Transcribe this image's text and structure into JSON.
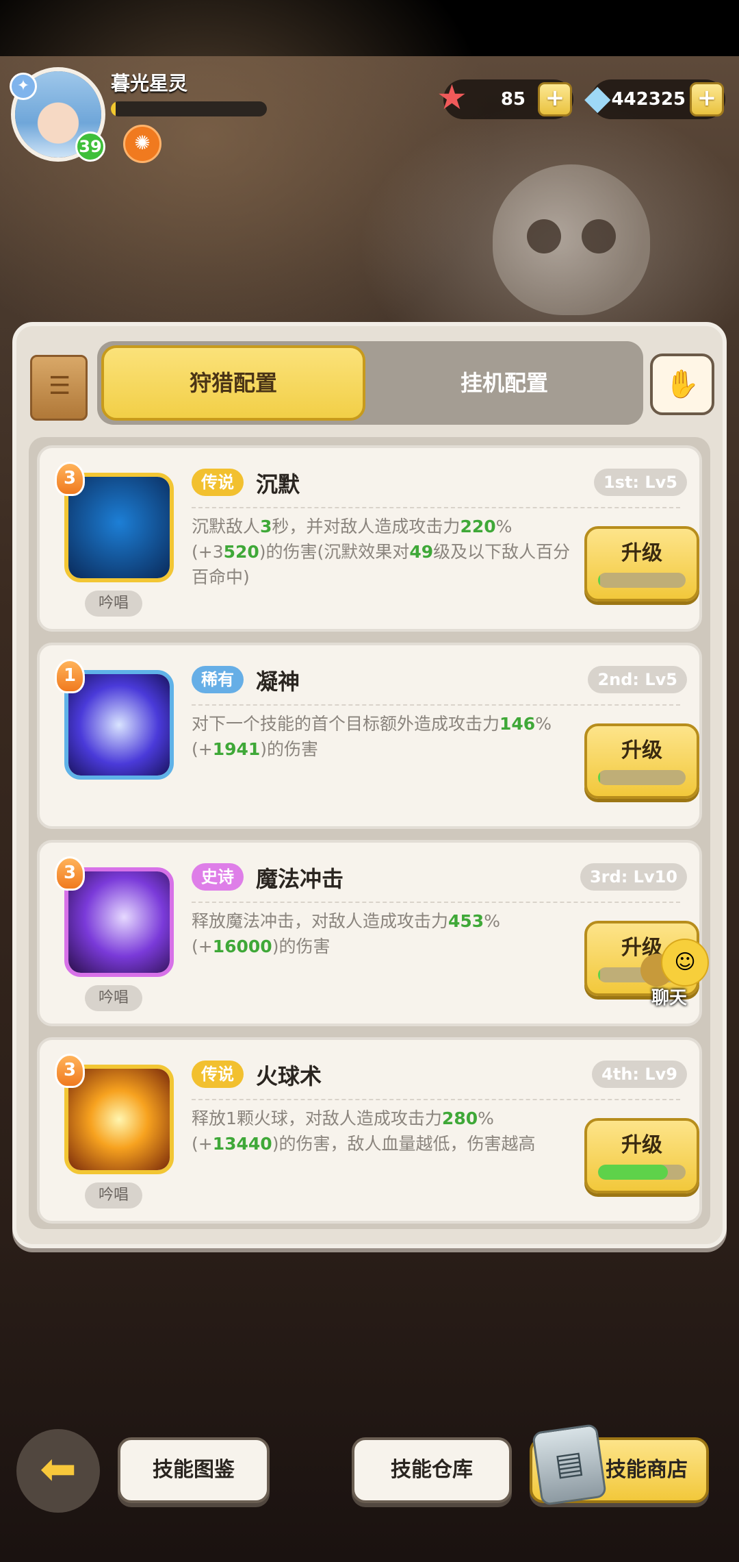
{
  "player": {
    "name": "暮光星灵",
    "level": "39",
    "xp_progress": 0.03
  },
  "resources": {
    "starfish": "85",
    "gems": "442325",
    "plus": "+"
  },
  "tabs": {
    "hunt": "狩猎配置",
    "idle": "挂机配置"
  },
  "skills": [
    {
      "rank": "3",
      "quality": "传说",
      "name": "沉默",
      "slot": "1st: Lv5",
      "cast": "吟唱",
      "desc": [
        "沉默敌人",
        "3",
        "秒，并对敌人造成攻击力",
        "220",
        "%(+3",
        "520",
        ")的伤害(沉默效果对",
        "49",
        "级及以下敌人百分百命中)"
      ],
      "upgrade": "升级",
      "progress": 0.02
    },
    {
      "rank": "1",
      "quality": "稀有",
      "name": "凝神",
      "slot": "2nd: Lv5",
      "cast": "",
      "desc": [
        "对下一个技能的首个目标额外造成攻击力",
        "146",
        "%(+",
        "1941",
        ")的伤害"
      ],
      "upgrade": "升级",
      "progress": 0.02
    },
    {
      "rank": "3",
      "quality": "史诗",
      "name": "魔法冲击",
      "slot": "3rd: Lv10",
      "cast": "吟唱",
      "desc": [
        "释放魔法冲击，对敌人造成攻击力",
        "453",
        "%(+",
        "16000",
        ")的伤害"
      ],
      "upgrade": "升级",
      "progress": 0.02
    },
    {
      "rank": "3",
      "quality": "传说",
      "name": "火球术",
      "slot": "4th: Lv9",
      "cast": "吟唱",
      "desc": [
        "释放1颗火球，对敌人造成攻击力",
        "280",
        "%(+",
        "13440",
        ")的伤害，敌人血量越低，伤害越高"
      ],
      "upgrade": "升级",
      "progress": 0.8
    }
  ],
  "chat": "聊天",
  "bottom": {
    "atlas": "技能图鉴",
    "warehouse": "技能仓库",
    "shop": "技能商店"
  },
  "colors": {
    "accent_yellow": "#f2c83b",
    "legend": "#f2c02f",
    "rare": "#66aee6",
    "epic": "#de7ee8",
    "value_green": "#3fa838"
  }
}
